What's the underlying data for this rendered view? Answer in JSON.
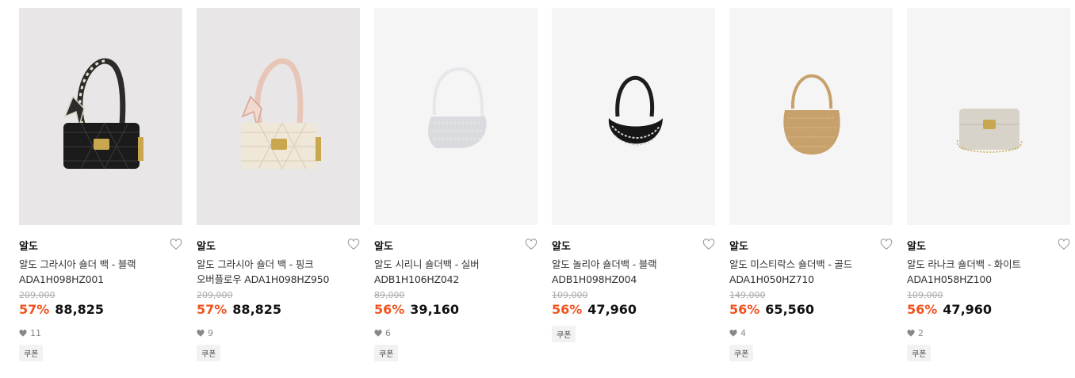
{
  "products": [
    {
      "brand": "알도",
      "name_line1": "알도 그라시아 숄더 백 - 블랙",
      "name_line2": "ADA1H098HZ001",
      "original_price": "209,000",
      "discount": "57%",
      "price": "88,825",
      "likes": "11",
      "coupon": "쿠폰",
      "image_bg": "#e8e6e6",
      "bag_color": "#1b1b1b",
      "image_icon": "black-quilted-bag-image"
    },
    {
      "brand": "알도",
      "name_line1": "알도 그라시아 숄더 백 - 핑크",
      "name_line2": "오버플로우 ADA1H098HZ950",
      "original_price": "209,000",
      "discount": "57%",
      "price": "88,825",
      "likes": "9",
      "coupon": "쿠폰",
      "image_bg": "#e8e6e6",
      "bag_color": "#efe7d7",
      "image_icon": "cream-quilted-bag-image"
    },
    {
      "brand": "알도",
      "name_line1": "알도 시리니 숄더백 - 실버",
      "name_line2": "ADB1H106HZ042",
      "original_price": "89,000",
      "discount": "56%",
      "price": "39,160",
      "likes": "6",
      "coupon": "쿠폰",
      "image_bg": "#f5f5f5",
      "bag_color": "#d9dbde",
      "image_icon": "silver-crystal-bag-image"
    },
    {
      "brand": "알도",
      "name_line1": "알도 놀리아 숄더백 - 블랙",
      "name_line2": "ADB1H098HZ004",
      "original_price": "109,000",
      "discount": "56%",
      "price": "47,960",
      "likes": "",
      "coupon": "쿠폰",
      "image_bg": "#f5f5f5",
      "bag_color": "#161616",
      "image_icon": "black-crystal-hobo-image"
    },
    {
      "brand": "알도",
      "name_line1": "알도 미스티락스 숄더백 - 골드",
      "name_line2": "ADA1H050HZ710",
      "original_price": "149,000",
      "discount": "56%",
      "price": "65,560",
      "likes": "4",
      "coupon": "쿠폰",
      "image_bg": "#f5f5f5",
      "bag_color": "#c7a06b",
      "image_icon": "gold-mesh-bag-image"
    },
    {
      "brand": "알도",
      "name_line1": "알도 라나크 숄더백 - 화이트",
      "name_line2": "ADA1H058HZ100",
      "original_price": "109,000",
      "discount": "56%",
      "price": "47,960",
      "likes": "2",
      "coupon": "쿠폰",
      "image_bg": "#f5f5f5",
      "bag_color": "#d8d3c9",
      "image_icon": "white-tweed-bag-image"
    }
  ],
  "colors": {
    "discount": "#f0541e",
    "price": "#111111",
    "original_price": "#aaaaaa"
  }
}
